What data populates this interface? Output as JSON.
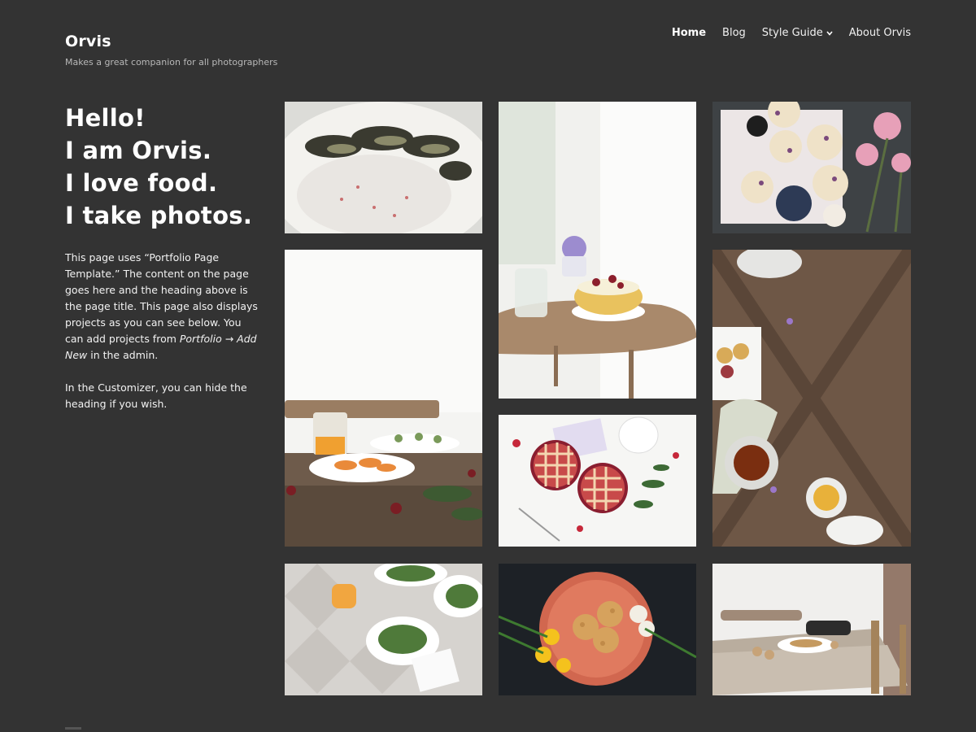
{
  "site": {
    "title": "Orvis",
    "description": "Makes a great companion for all photographers"
  },
  "nav": {
    "items": [
      {
        "label": "Home",
        "active": true
      },
      {
        "label": "Blog"
      },
      {
        "label": "Style Guide",
        "has_dropdown": true,
        "icon": "chevron-down-icon"
      },
      {
        "label": "About Orvis"
      }
    ]
  },
  "intro": {
    "headline": [
      "Hello!",
      "I am Orvis.",
      "I love food.",
      "I take photos."
    ],
    "para1": {
      "text": "This page uses “Portfolio Page Template.” The content on the page goes here and the heading above is the page title. This page also displays projects as you can see below. You can add projects from ",
      "em": "Portfolio → Add New",
      "tail": " in the admin."
    },
    "para2": "In the Customizer, you can hide the heading if you wish."
  },
  "portfolio": {
    "items": [
      {
        "subject": "oysters on salt"
      },
      {
        "subject": "fruit bowl on table"
      },
      {
        "subject": "pastries with flowers"
      },
      {
        "subject": "breakfast table"
      },
      {
        "subject": "wooden table with tea"
      },
      {
        "subject": "berry pies"
      },
      {
        "subject": "salads on tile"
      },
      {
        "subject": "cookies with daffodils"
      },
      {
        "subject": "rustic dining table"
      }
    ]
  },
  "colors": {
    "background": "#333333",
    "text": "#ffffff",
    "muted": "#b8b8b8"
  }
}
